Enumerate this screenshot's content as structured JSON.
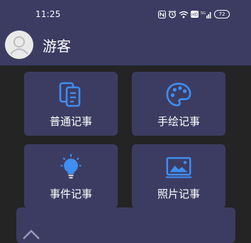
{
  "status_bar": {
    "time": "11:25",
    "battery": "72",
    "icons": [
      "nfc-icon",
      "alarm-icon",
      "wifi-icon",
      "hd-icon",
      "signal-icon",
      "battery-icon"
    ]
  },
  "profile": {
    "username": "游客",
    "avatar_icon": "user-avatar-icon"
  },
  "tiles": [
    {
      "label": "普通记事",
      "icon": "note-icon",
      "color": "#3f8ef0"
    },
    {
      "label": "手绘记事",
      "icon": "palette-icon",
      "color": "#3f8ef0"
    },
    {
      "label": "事件记事",
      "icon": "lightbulb-icon",
      "color": "#3f8ef0"
    },
    {
      "label": "照片记事",
      "icon": "photo-icon",
      "color": "#3f8ef0"
    }
  ],
  "colors": {
    "background": "#242424",
    "panel": "#3c3c63",
    "accent": "#3f8ef0"
  }
}
